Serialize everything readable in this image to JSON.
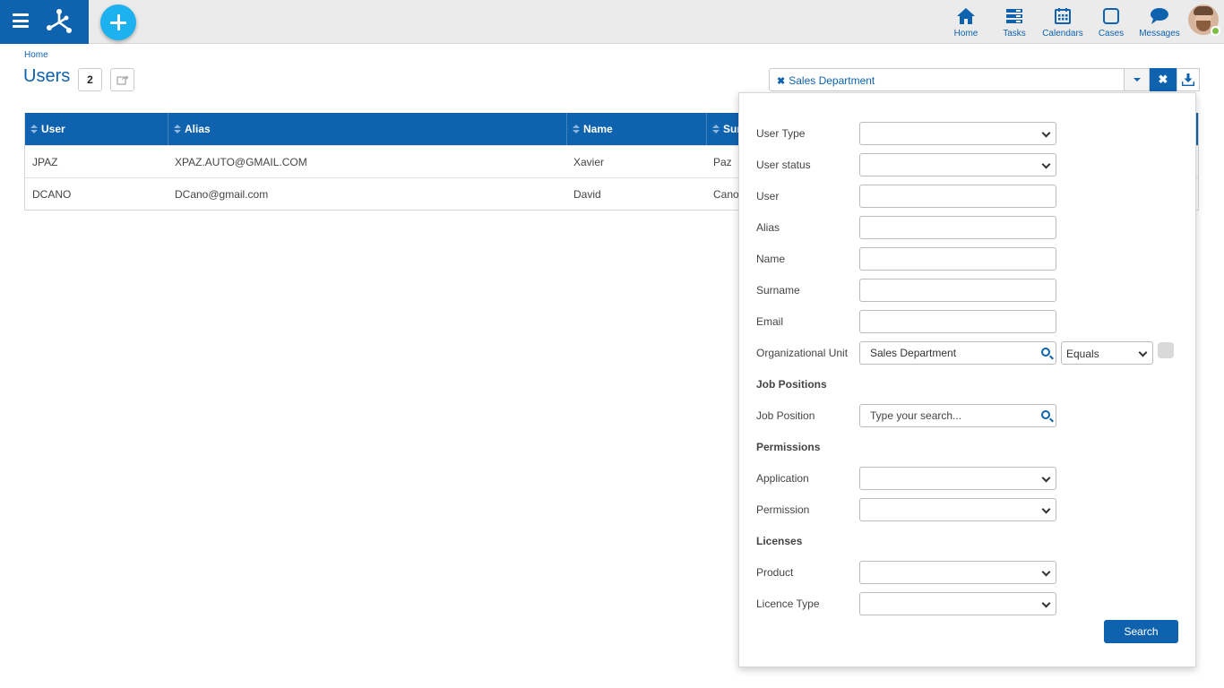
{
  "nav": {
    "items": [
      {
        "label": "Home",
        "icon": "home-icon"
      },
      {
        "label": "Tasks",
        "icon": "tasks-icon"
      },
      {
        "label": "Calendars",
        "icon": "calendar-icon"
      },
      {
        "label": "Cases",
        "icon": "cases-icon"
      },
      {
        "label": "Messages",
        "icon": "messages-icon"
      }
    ],
    "accent": "#0f62ae",
    "add_button_color": "#1db1ef"
  },
  "breadcrumb": "Home",
  "page": {
    "title": "Users",
    "count": "2"
  },
  "filter": {
    "chip_label": "Sales Department",
    "chip_remove": "✖",
    "clear_label": "✖"
  },
  "table": {
    "columns": [
      "User",
      "Alias",
      "Name",
      "Sur"
    ],
    "rows": [
      {
        "user": "JPAZ",
        "alias": "XPAZ.AUTO@GMAIL.COM",
        "name": "Xavier",
        "surname": "Paz"
      },
      {
        "user": "DCANO",
        "alias": "DCano@gmail.com",
        "name": "David",
        "surname": "Cano"
      }
    ]
  },
  "panel": {
    "user_type": "User Type",
    "user_status": "User status",
    "user": "User",
    "alias": "Alias",
    "name": "Name",
    "surname": "Surname",
    "email": "Email",
    "org_unit": "Organizational Unit",
    "org_unit_value": "Sales Department",
    "org_unit_operator": "Equals",
    "job_positions_heading": "Job Positions",
    "job_position": "Job Position",
    "job_position_placeholder": "Type your search...",
    "permissions_heading": "Permissions",
    "application": "Application",
    "permission": "Permission",
    "licenses_heading": "Licenses",
    "product": "Product",
    "licence_type": "Licence Type",
    "search_button": "Search"
  }
}
